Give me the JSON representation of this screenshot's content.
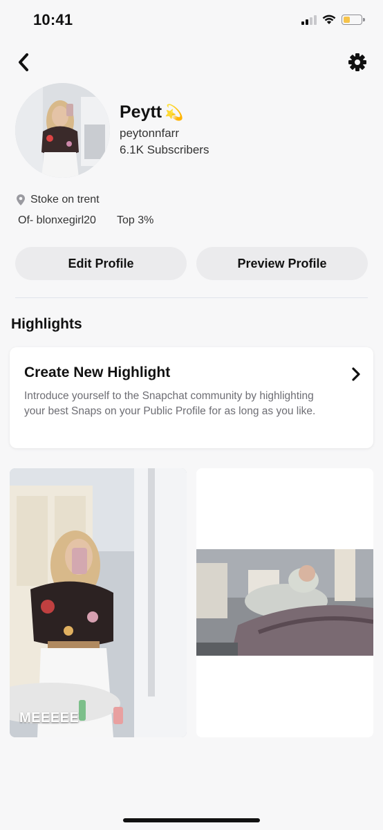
{
  "status_bar": {
    "time": "10:41",
    "signal_bars_active": 2,
    "battery_level": 0.4,
    "battery_color": "#f6c34a"
  },
  "nav": {
    "back_icon": "chevron-left-icon",
    "settings_icon": "gear-icon"
  },
  "profile": {
    "name": "Peytt",
    "name_emoji": "💫",
    "username": "peytonnfarr",
    "subscribers": "6.1K Subscribers",
    "location": "Stoke on trent",
    "bio_left": "Of- blonxegirl20",
    "bio_right": "Top 3%"
  },
  "buttons": {
    "edit": "Edit Profile",
    "preview": "Preview Profile"
  },
  "highlights": {
    "title": "Highlights",
    "create_title": "Create New Highlight",
    "create_description": "Introduce yourself to the Snapchat community by highlighting your best Snaps on your Public Profile for as long as you like.",
    "tiles": [
      {
        "caption": "MEEEEE"
      },
      {
        "caption": ""
      }
    ]
  },
  "colors": {
    "background": "#f7f7f8",
    "button_bg": "#ebebed",
    "secondary_text": "#6d6d73"
  }
}
